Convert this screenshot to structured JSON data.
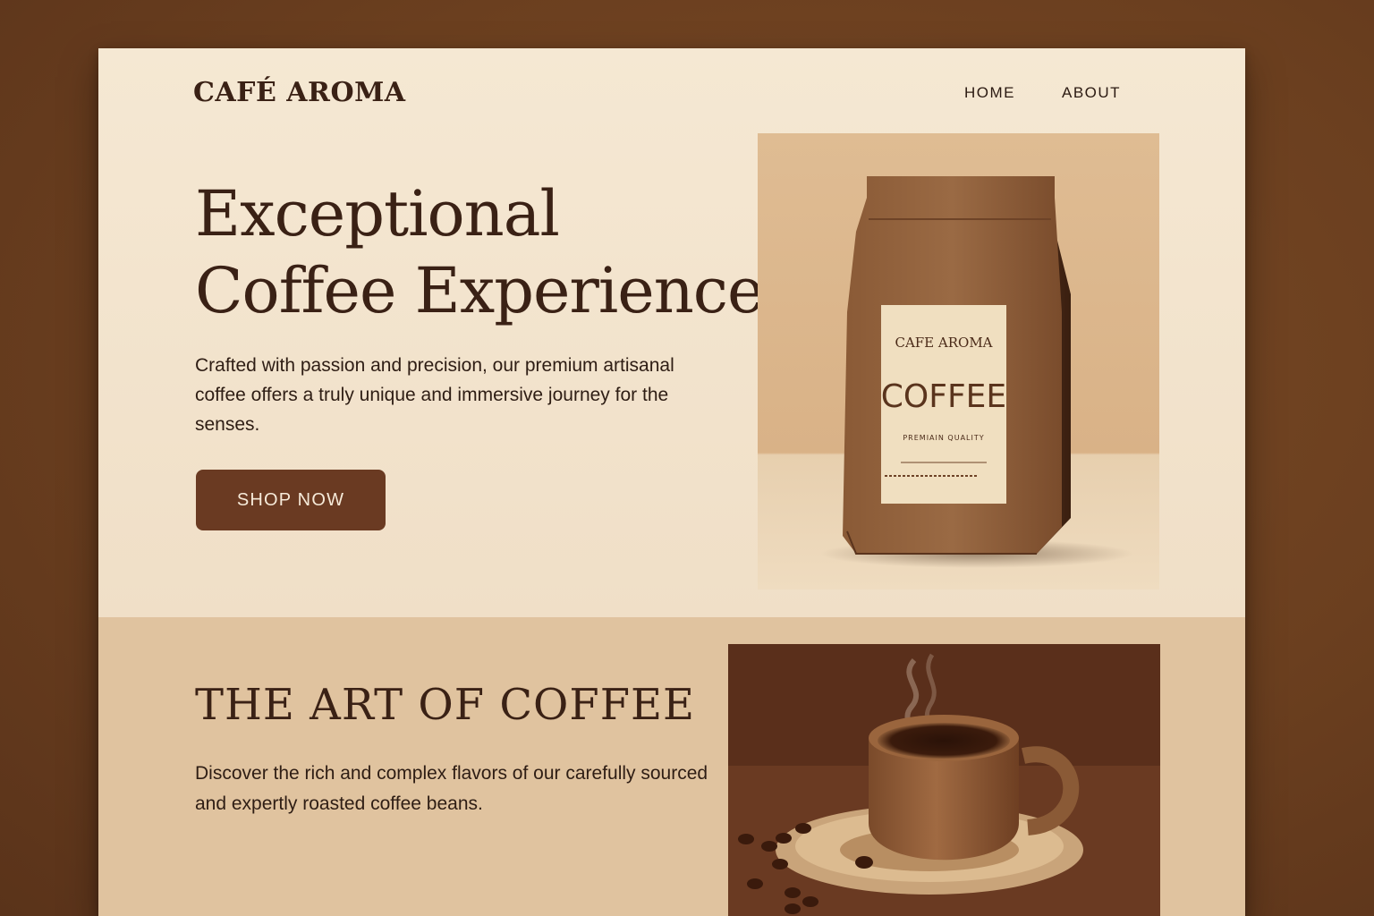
{
  "brand": {
    "name": "CAFÉ AROMA"
  },
  "nav": {
    "items": [
      "HOME",
      "ABOUT"
    ]
  },
  "hero": {
    "title_line1": "Exceptional",
    "title_line2": "Coffee Experience",
    "description": "Crafted with passion and precision, our premium artisanal coffee offers a truly unique and immersive journey for the senses.",
    "cta_label": "SHOP NOW"
  },
  "product_image": {
    "label_brand": "CAFE AROMA",
    "label_product": "COFFEE",
    "label_tagline": "PREMIAIN QUALITY"
  },
  "section": {
    "title": "THE ART OF COFFEE",
    "description": "Discover the rich and complex flavors of our carefully sourced and expertly roasted coffee beans."
  },
  "colors": {
    "background": "#6b3f1f",
    "page": "#f3e4cd",
    "section_bg": "#e0c39f",
    "accent": "#6a3a22",
    "text": "#3a2115"
  },
  "icons": {
    "product": "coffee-bag-illustration",
    "cup": "coffee-cup-illustration"
  }
}
